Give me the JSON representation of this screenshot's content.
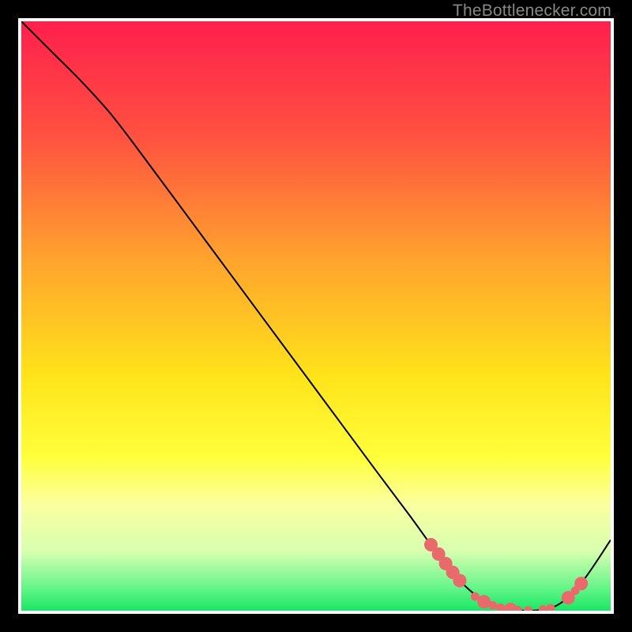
{
  "watermark": "TheBottlenecker.com",
  "chart_data": {
    "type": "line",
    "title": "",
    "xlabel": "",
    "ylabel": "",
    "xlim": [
      0,
      100
    ],
    "ylim": [
      0,
      100
    ],
    "background_gradient": {
      "stops": [
        {
          "offset": 0,
          "color": "#ff1f4d"
        },
        {
          "offset": 20,
          "color": "#ff5340"
        },
        {
          "offset": 40,
          "color": "#ffa22e"
        },
        {
          "offset": 60,
          "color": "#ffe31a"
        },
        {
          "offset": 74,
          "color": "#ffff3a"
        },
        {
          "offset": 82,
          "color": "#fbffa0"
        },
        {
          "offset": 90,
          "color": "#d7ffb0"
        },
        {
          "offset": 96,
          "color": "#67f58a"
        },
        {
          "offset": 100,
          "color": "#18e865"
        }
      ]
    },
    "series": [
      {
        "name": "curve",
        "stroke": "#000000",
        "stroke_width": 2,
        "x": [
          0,
          3,
          6,
          10,
          15,
          20,
          30,
          40,
          50,
          60,
          66,
          70,
          74,
          78,
          82,
          86,
          90,
          93,
          96,
          100
        ],
        "y": [
          100,
          97,
          94,
          90,
          84.5,
          78,
          64.5,
          51,
          37.5,
          24,
          16,
          10.5,
          5.5,
          2,
          0.4,
          0,
          0.5,
          2.5,
          6,
          12
        ]
      }
    ],
    "markers": {
      "name": "highlight-dots",
      "fill": "#e86a6a",
      "stroke": "#e86a6a",
      "radius_small": 5,
      "radius_large": 8,
      "points": [
        {
          "x": 69.5,
          "y": 11.2,
          "r": "l"
        },
        {
          "x": 70.8,
          "y": 9.6,
          "r": "l"
        },
        {
          "x": 72.0,
          "y": 8.0,
          "r": "l"
        },
        {
          "x": 73.2,
          "y": 6.5,
          "r": "l"
        },
        {
          "x": 74.4,
          "y": 5.1,
          "r": "l"
        },
        {
          "x": 77.0,
          "y": 2.4,
          "r": "s"
        },
        {
          "x": 78.5,
          "y": 1.5,
          "r": "l"
        },
        {
          "x": 80.0,
          "y": 0.9,
          "r": "s"
        },
        {
          "x": 81.3,
          "y": 0.5,
          "r": "s"
        },
        {
          "x": 83.0,
          "y": 0.2,
          "r": "l"
        },
        {
          "x": 84.2,
          "y": 0.1,
          "r": "s"
        },
        {
          "x": 86.0,
          "y": 0.05,
          "r": "s"
        },
        {
          "x": 88.5,
          "y": 0.2,
          "r": "s"
        },
        {
          "x": 89.8,
          "y": 0.4,
          "r": "s"
        },
        {
          "x": 92.8,
          "y": 2.2,
          "r": "l"
        },
        {
          "x": 94.0,
          "y": 3.4,
          "r": "s"
        },
        {
          "x": 95.0,
          "y": 4.6,
          "r": "l"
        }
      ]
    }
  }
}
